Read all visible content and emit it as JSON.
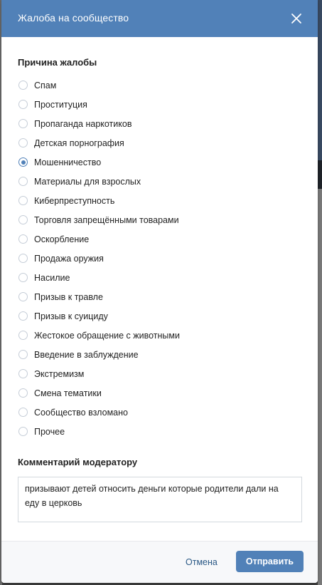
{
  "dialog": {
    "title": "Жалоба на сообщество"
  },
  "reasons": {
    "heading": "Причина жалобы",
    "options": [
      "Спам",
      "Проституция",
      "Пропаганда наркотиков",
      "Детская порнография",
      "Мошенничество",
      "Материалы для взрослых",
      "Киберпреступность",
      "Торговля запрещёнными товарами",
      "Оскорбление",
      "Продажа оружия",
      "Насилие",
      "Призыв к травле",
      "Призыв к суициду",
      "Жестокое обращение с животными",
      "Введение в заблуждение",
      "Экстремизм",
      "Смена тематики",
      "Сообщество взломано",
      "Прочее"
    ],
    "selected_index": 4
  },
  "comment": {
    "heading": "Комментарий модератору",
    "value": "призывают детей относить деньги которые родители дали на еду в церковь"
  },
  "footer": {
    "cancel_label": "Отмена",
    "submit_label": "Отправить"
  },
  "colors": {
    "accent": "#5181b8",
    "link": "#2a5885"
  },
  "icons": {
    "close": "close-icon"
  }
}
